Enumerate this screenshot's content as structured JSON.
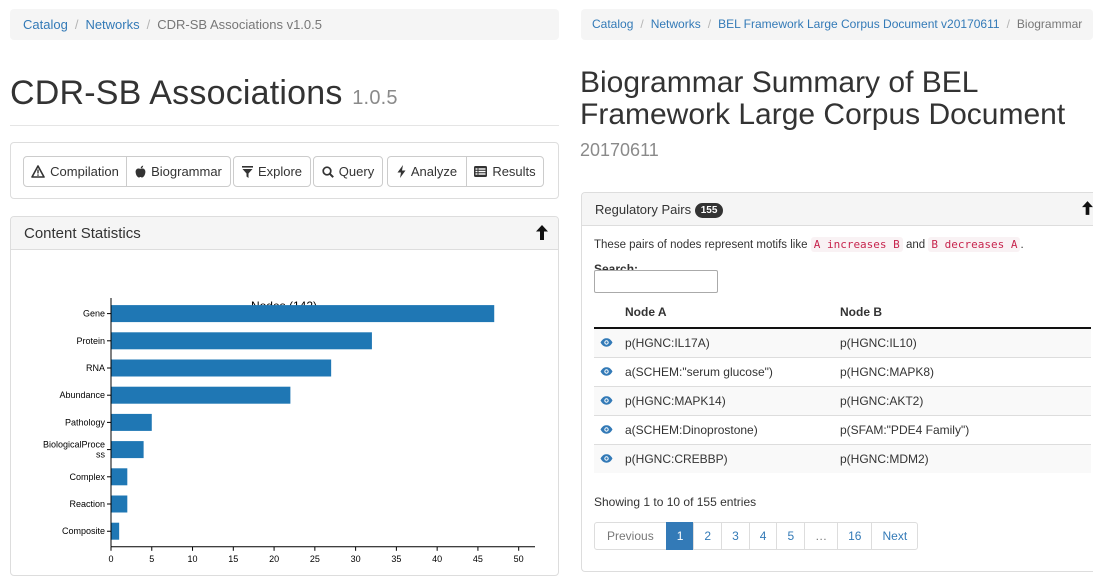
{
  "left": {
    "breadcrumb": {
      "catalog": "Catalog",
      "networks": "Networks",
      "current": "CDR-SB Associations v1.0.5"
    },
    "title": "CDR-SB Associations",
    "version": "1.0.5",
    "toolbar": {
      "compilation": "Compilation",
      "biogrammar": "Biogrammar",
      "explore": "Explore",
      "query": "Query",
      "analyze": "Analyze",
      "results": "Results"
    },
    "panel_title": "Content Statistics"
  },
  "chart_data": {
    "type": "bar",
    "orientation": "horizontal",
    "title": "Nodes (142)",
    "categories": [
      "Gene",
      "Protein",
      "RNA",
      "Abundance",
      "Pathology",
      "BiologicalProcess",
      "Complex",
      "Reaction",
      "Composite"
    ],
    "values": [
      47,
      32,
      27,
      22,
      5,
      4,
      2,
      2,
      1
    ],
    "xlim": [
      0,
      52
    ],
    "xticks": [
      "0",
      "5",
      "10",
      "15",
      "20",
      "25",
      "30",
      "35",
      "40",
      "45",
      "50"
    ],
    "bar_color": "#1f77b4",
    "grid": false
  },
  "right": {
    "breadcrumb": {
      "catalog": "Catalog",
      "networks": "Networks",
      "document": "BEL Framework Large Corpus Document v20170611",
      "current": "Biogrammar"
    },
    "title_line1": "Biogrammar Summary of BEL",
    "title_line2": "Framework Large Corpus Document",
    "subtitle": "20170611",
    "panel_title": "Regulatory Pairs",
    "badge": "155",
    "description": {
      "prefix": "These pairs of nodes represent motifs like",
      "code1": "A increases B",
      "middle": "and",
      "code2": "B decreases A",
      "suffix": "."
    },
    "search_label": "Search:",
    "table": {
      "headers": [
        "Node A",
        "Node B"
      ],
      "rows": [
        [
          "p(HGNC:IL17A)",
          "p(HGNC:IL10)"
        ],
        [
          "a(SCHEM:\"serum glucose\")",
          "p(HGNC:MAPK8)"
        ],
        [
          "p(HGNC:MAPK14)",
          "p(HGNC:AKT2)"
        ],
        [
          "a(SCHEM:Dinoprostone)",
          "p(SFAM:\"PDE4 Family\")"
        ],
        [
          "p(HGNC:CREBBP)",
          "p(HGNC:MDM2)"
        ]
      ]
    },
    "info": "Showing 1 to 10 of 155 entries",
    "pagination": [
      "Previous",
      "1",
      "2",
      "3",
      "4",
      "5",
      "…",
      "16",
      "Next"
    ],
    "active_page": "1",
    "accent": "#337ab7"
  }
}
